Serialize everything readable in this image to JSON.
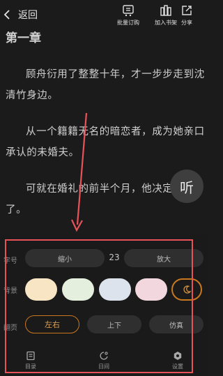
{
  "header": {
    "back_label": "返回",
    "actions": [
      {
        "label": "批量订购",
        "icon": "batch-order-icon"
      },
      {
        "label": "加入书架",
        "icon": "bookshelf-icon"
      },
      {
        "label": "分享",
        "icon": "share-icon"
      }
    ]
  },
  "content": {
    "chapter_title": "第一章",
    "paragraphs": [
      "顾舟衍用了整整十年，才一步步走到沈清竹身边。",
      "从一个籍籍无名的暗恋者，成为她亲口承认的未婚夫。",
      "可就在婚礼的前半个月，他决定不要了。"
    ]
  },
  "listen_button": {
    "label": "听"
  },
  "settings": {
    "font_size": {
      "label": "字号",
      "shrink": "缩小",
      "value": "23",
      "enlarge": "放大"
    },
    "background": {
      "label": "背景",
      "swatches": [
        "#f7e5c3",
        "#e4efdd",
        "#dde3ec",
        "#f2d7de"
      ],
      "night_icon": "moon-icon",
      "accent": "#c9781f"
    },
    "page_turn": {
      "label": "翻页",
      "options": [
        "左右",
        "上下",
        "仿真"
      ],
      "selected": "左右"
    }
  },
  "bottom_nav": [
    {
      "label": "目录",
      "icon": "catalog-icon"
    },
    {
      "label": "日间",
      "icon": "day-mode-icon"
    },
    {
      "label": "设置",
      "icon": "settings-icon"
    }
  ],
  "annotation": {
    "color": "#e8535a"
  }
}
